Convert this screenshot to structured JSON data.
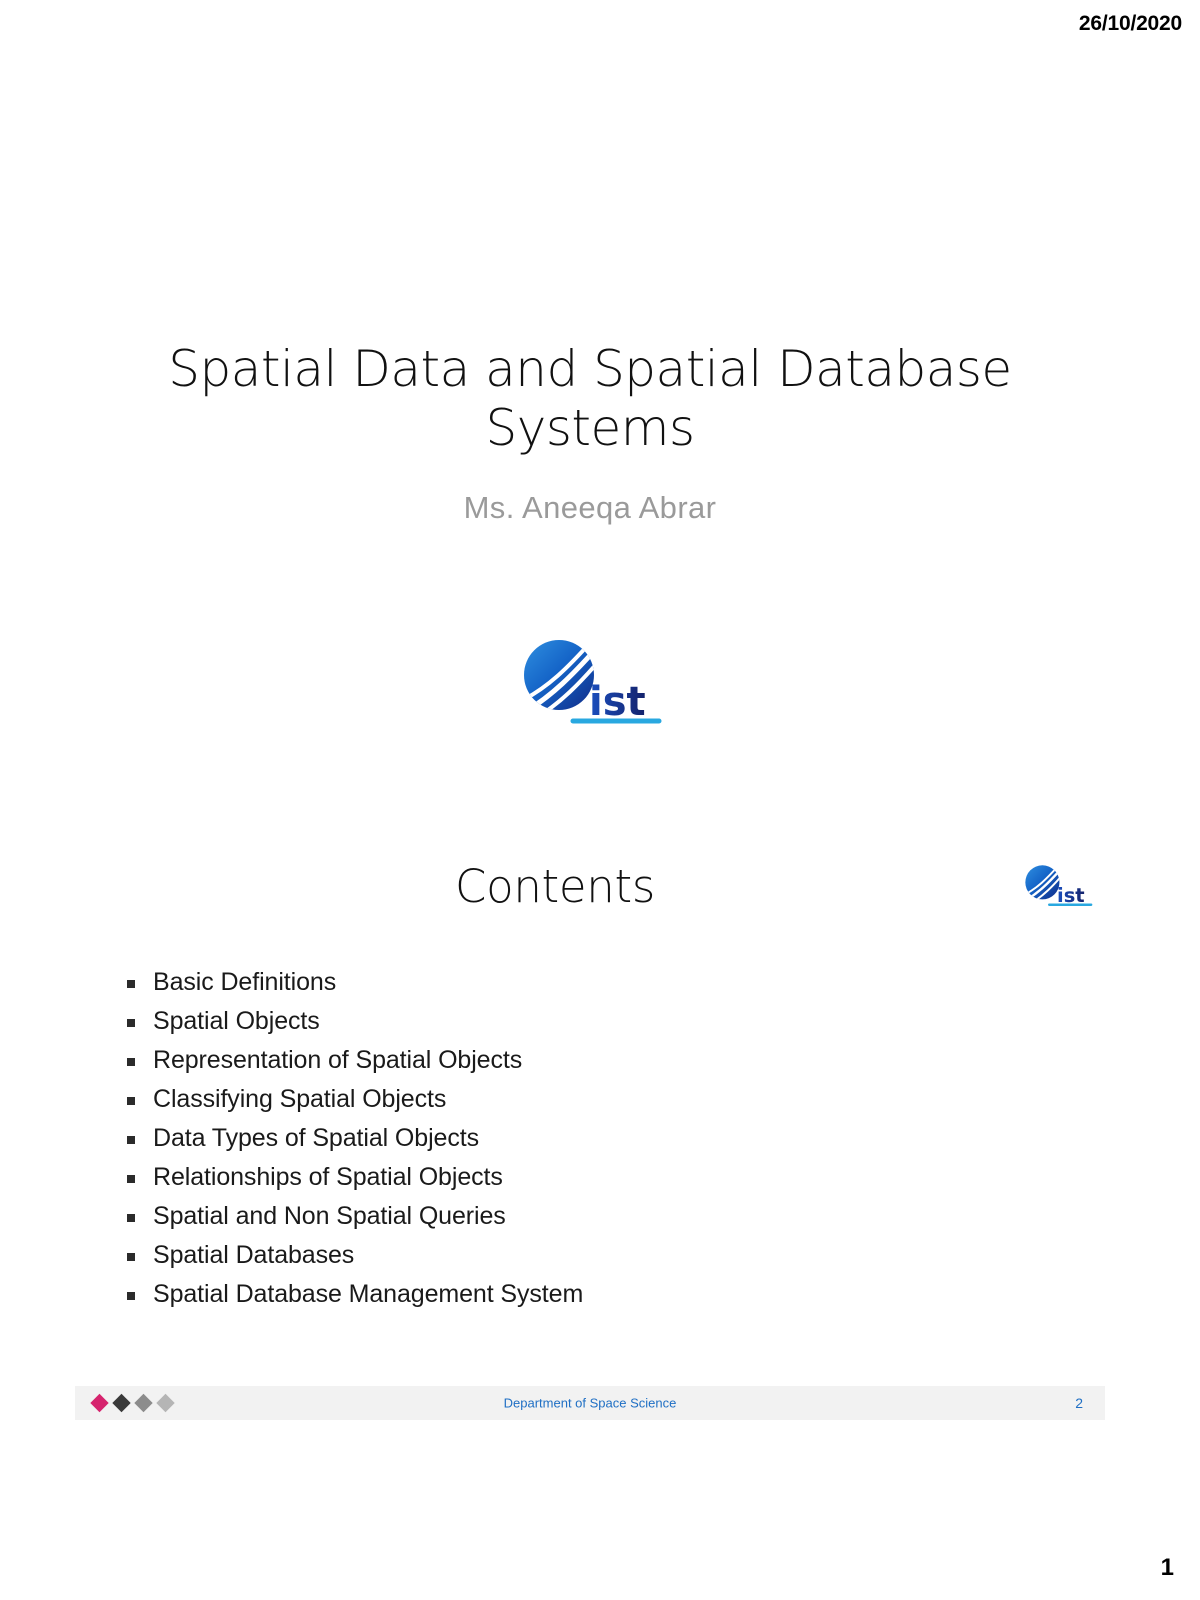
{
  "header": {
    "date": "26/10/2020"
  },
  "title_slide": {
    "heading": "Spatial Data and Spatial Database Systems",
    "subtitle": "Ms. Aneeqa Abrar",
    "logo_name": "ist-logo",
    "logo_text": "ist"
  },
  "contents_slide": {
    "heading": "Contents",
    "logo_name": "ist-logo",
    "bullets": [
      "Basic Definitions",
      "Spatial Objects",
      "Representation of Spatial Objects",
      "Classifying Spatial Objects",
      "Data Types of Spatial Objects",
      "Relationships of Spatial Objects",
      "Spatial and Non Spatial Queries",
      "Spatial Databases",
      "Spatial Database Management System"
    ],
    "footer": {
      "center_text": "Department of Space Science",
      "page_label": "2",
      "diamond_colors": [
        "#d6246e",
        "#3a3a3a",
        "#8c8c8c",
        "#b5b5b5"
      ]
    }
  },
  "page_number": "1",
  "colors": {
    "logo_blue": "#1565c8",
    "logo_dark_navy": "#14226b",
    "logo_cyan": "#29a8e0",
    "footer_band": "#f2f2f2",
    "footer_text_blue": "#1f6fc4",
    "subtitle_gray": "#9a9a9a",
    "accent_pink": "#d6246e"
  }
}
